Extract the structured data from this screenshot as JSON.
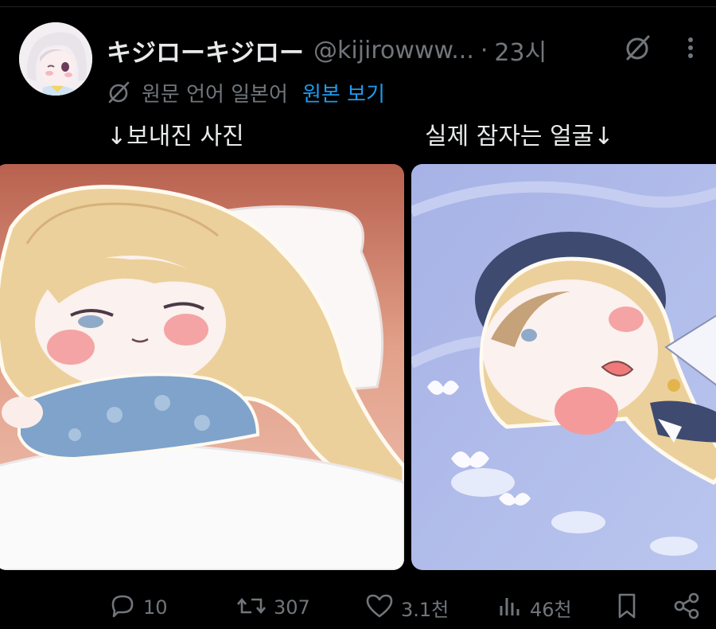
{
  "tweet": {
    "display_name": "キジローキジロー",
    "handle": "@kijirowww...",
    "separator": "·",
    "time": "23시"
  },
  "translation": {
    "text": "원문 언어 일본어",
    "show_original": "원본 보기"
  },
  "captions": {
    "left": "↓보내진 사진",
    "right": "실제 잠자는 얼굴↓"
  },
  "actions": {
    "replies": "10",
    "reposts": "307",
    "likes": "3.1천",
    "views": "46천"
  },
  "icons": [
    "grok-icon",
    "more-icon",
    "translate-icon",
    "reply-icon",
    "repost-icon",
    "like-icon",
    "views-icon",
    "bookmark-icon",
    "share-icon"
  ],
  "colors": {
    "background": "#000000",
    "text": "#e7e9ea",
    "secondary": "#71767b",
    "link": "#1d9bf0"
  }
}
